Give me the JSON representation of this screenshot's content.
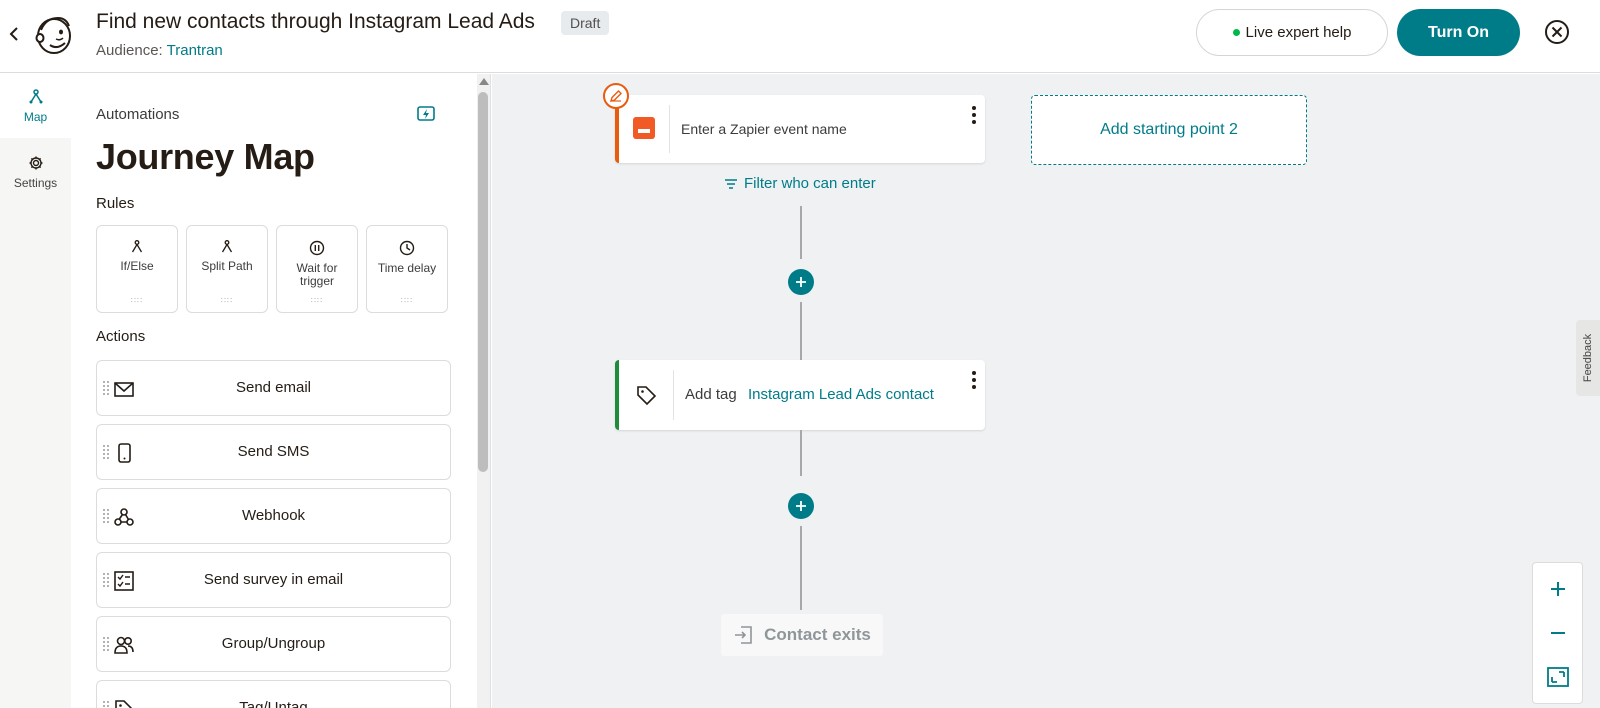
{
  "header": {
    "title": "Find new contacts through Instagram Lead Ads",
    "status_badge": "Draft",
    "audience_label": "Audience:",
    "audience_name": "Trantran",
    "live_help": "Live expert help",
    "turn_on": "Turn On"
  },
  "rail": {
    "map": "Map",
    "settings": "Settings"
  },
  "panel": {
    "label": "Automations",
    "title": "Journey Map",
    "rules_heading": "Rules",
    "rules": [
      "If/Else",
      "Split Path",
      "Wait for trigger",
      "Time delay"
    ],
    "actions_heading": "Actions",
    "actions": [
      "Send email",
      "Send SMS",
      "Webhook",
      "Send survey in email",
      "Group/Ungroup",
      "Tag/Untag"
    ]
  },
  "canvas": {
    "trigger_label": "Enter a Zapier event name",
    "start_point_2": "Add starting point 2",
    "filter": "Filter who can enter",
    "action_prefix": "Add tag",
    "tag_name": "Instagram Lead Ads contact",
    "exit": "Contact exits",
    "feedback": "Feedback"
  },
  "colors": {
    "brand": "#007c89",
    "trigger_accent": "#e85c0d",
    "action_accent": "#1e8c3a",
    "canvas_bg": "#eff1f3"
  }
}
